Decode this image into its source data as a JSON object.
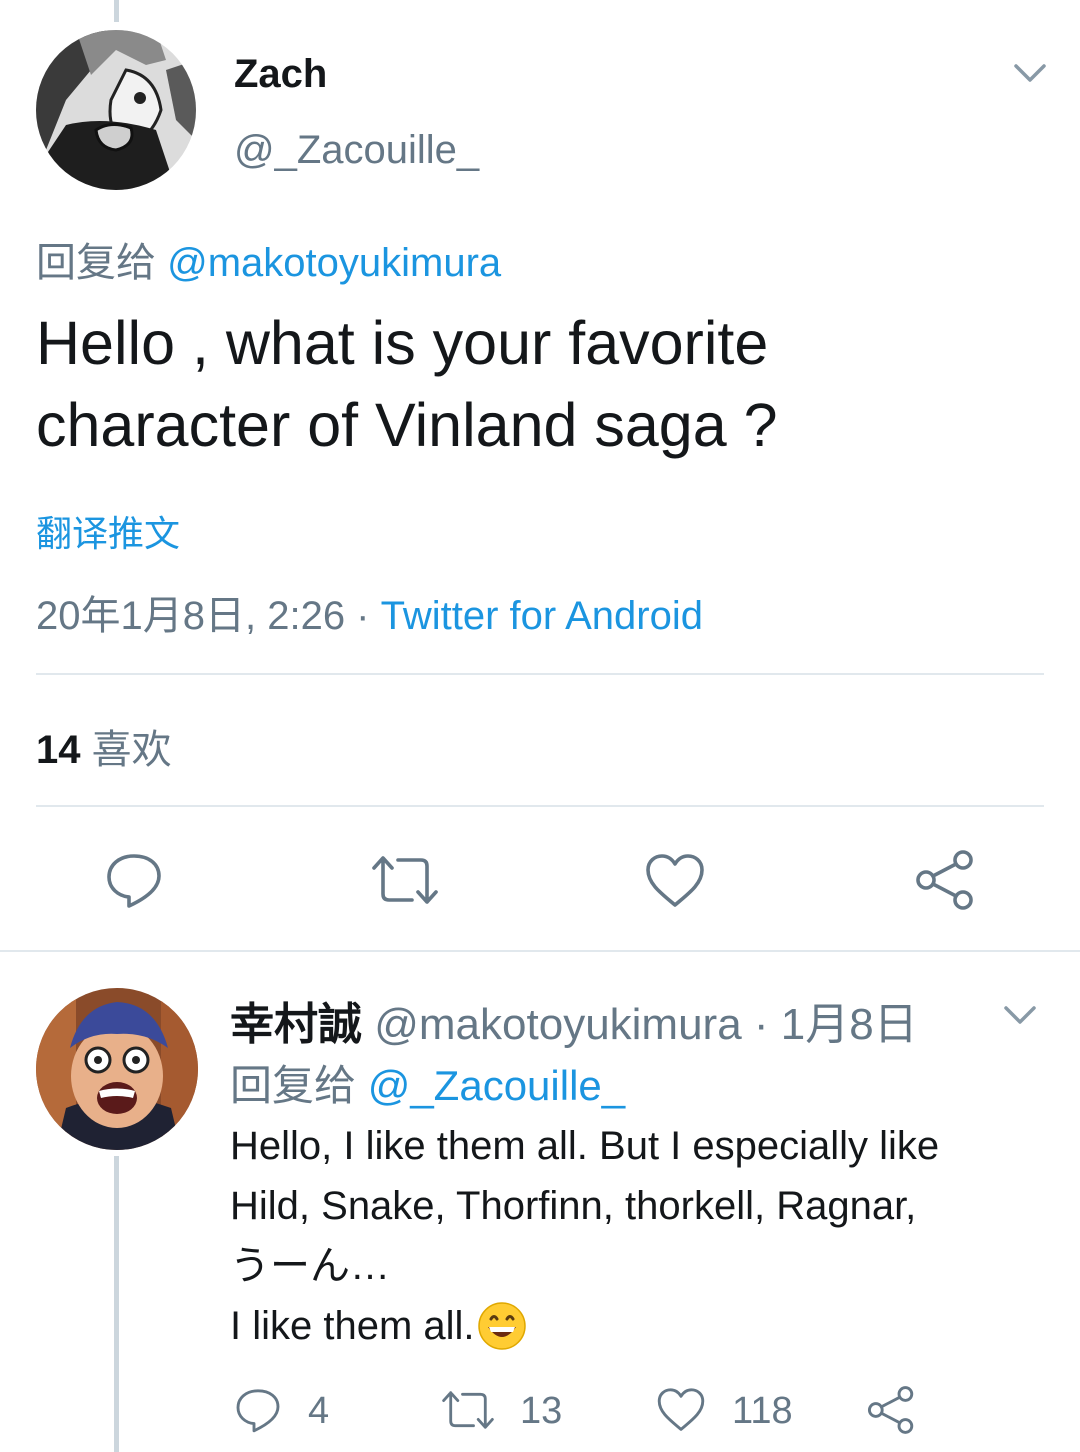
{
  "main_tweet": {
    "author_name": "Zach",
    "author_handle": "@_Zacouille_",
    "reply_prefix": "回复给",
    "reply_to": "@makotoyukimura",
    "text_line1": "Hello , what is your favorite",
    "text_line2": "character of Vinland saga ?",
    "translate_label": "翻译推文",
    "timestamp": "20年1月8日, 2:26",
    "separator": " · ",
    "source": "Twitter for Android",
    "likes_count": "14",
    "likes_label": "喜欢"
  },
  "reply_tweet": {
    "author_name": "幸村誠",
    "author_handle": "@makotoyukimura",
    "date": "· 1月8日",
    "reply_prefix": "回复给",
    "reply_to": "@_Zacouille_",
    "line1": "Hello, I like them all. But I especially like",
    "line2": "Hild, Snake, Thorfinn, thorkell, Ragnar,",
    "line3": "うーん…",
    "line4": "I like them all.",
    "emoji": "😄",
    "reply_count": "4",
    "retweet_count": "13",
    "like_count": "118"
  },
  "icons": {
    "menu": "chevron-down-icon",
    "reply": "speech-bubble-icon",
    "retweet": "retweet-icon",
    "like": "heart-icon",
    "share": "share-icon"
  },
  "colors": {
    "link": "#1b95e0",
    "secondary_text": "#657786",
    "primary_text": "#14171a",
    "divider": "#e1e8ed",
    "thread_line": "#ccd6dd"
  }
}
